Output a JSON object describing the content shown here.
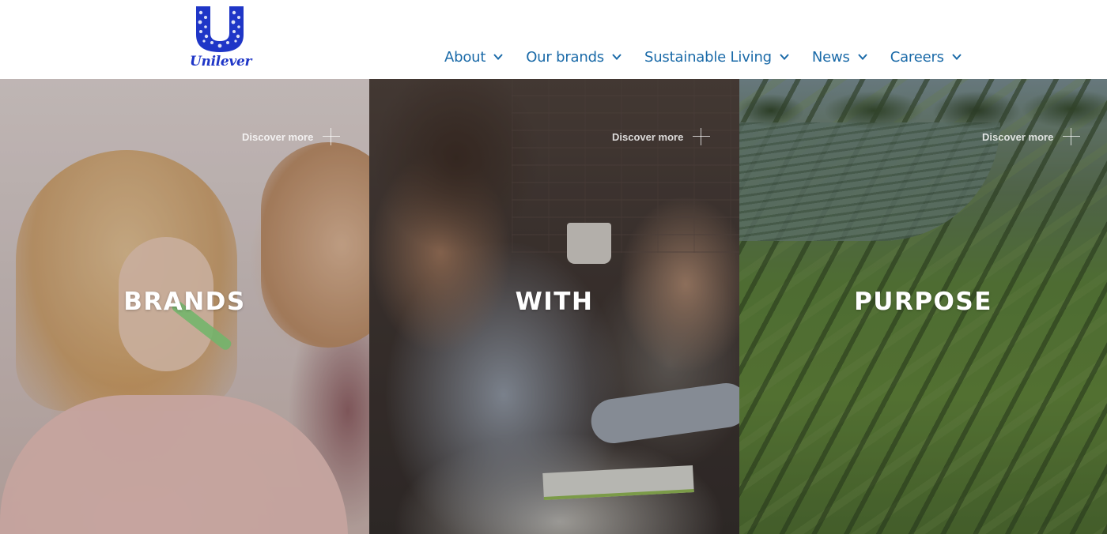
{
  "brand": {
    "name": "Unilever",
    "logo_color": "#1f36c7"
  },
  "nav": {
    "items": [
      {
        "label": "About",
        "icon": "chevron-down-icon"
      },
      {
        "label": "Our brands",
        "icon": "chevron-down-icon"
      },
      {
        "label": "Sustainable Living",
        "icon": "chevron-down-icon"
      },
      {
        "label": "News",
        "icon": "chevron-down-icon"
      },
      {
        "label": "Careers",
        "icon": "chevron-down-icon"
      }
    ],
    "color": "#1a6aa8"
  },
  "hero": {
    "panels": [
      {
        "word": "BRANDS",
        "discover_label": "Discover more",
        "icon": "plus-icon"
      },
      {
        "word": "WITH",
        "discover_label": "Discover more",
        "icon": "plus-icon"
      },
      {
        "word": "PURPOSE",
        "discover_label": "Discover more",
        "icon": "plus-icon"
      }
    ]
  }
}
